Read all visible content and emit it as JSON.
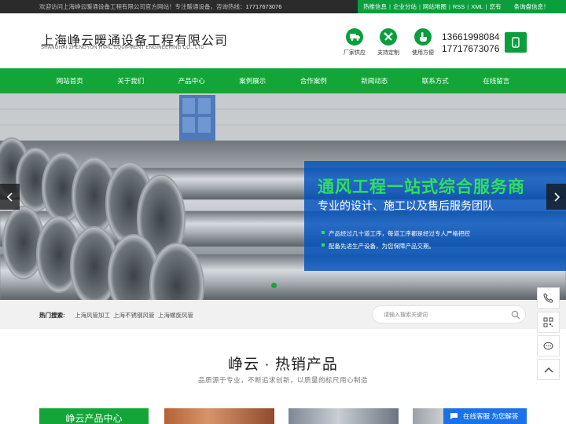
{
  "topbar": {
    "welcome": "欢迎访问上海峥云暖通设备工程有限公司官方网站！专注暖通设备，咨询热线：",
    "hotline": "17717673076",
    "links": [
      "热推信息",
      "企业分站",
      "网站地图",
      "RSS",
      "XML",
      "您有",
      "条询盘信息！"
    ]
  },
  "header": {
    "company_cn": "上海峥云暖通设备工程有限公司",
    "company_en": "SHANGHAI ZHENGYUN HVAC EQUIPMENT ENGINEERING CO., LTD",
    "features": [
      {
        "label": "厂家供应",
        "icon": "truck-icon"
      },
      {
        "label": "支持定制",
        "icon": "tools-icon"
      },
      {
        "label": "使用方便",
        "icon": "hand-icon"
      }
    ],
    "phone1": "13661998084",
    "phone2": "17717673076"
  },
  "nav": [
    "网站首页",
    "关于我们",
    "产品中心",
    "案例展示",
    "合作案例",
    "新闻动态",
    "联系方式",
    "在线留言"
  ],
  "banner": {
    "headline": "通风工程一站式综合服务商",
    "subheadline": "专业的设计、施工以及售后服务团队",
    "points": [
      "产品经过几十道工序，每道工序都是经过专人严格把控",
      "配备先进生产设备，为您保障产品交期。"
    ]
  },
  "search": {
    "hot_label": "热门搜索:",
    "hot_links": [
      "上海风管加工",
      "上海不锈钢风管",
      "上海螺旋风管"
    ],
    "placeholder": "请输入搜索关键词"
  },
  "products": {
    "title": "峥云 · 热销产品",
    "subtitle": "品质源于专业，不断追求创新，以质量的标尺用心制造",
    "center_label": "峥云产品中心"
  },
  "chat": {
    "label": "在线客服 为您解答"
  },
  "colors": {
    "brand_green": "#13a538",
    "panel_blue": "#0052be",
    "headline_green": "#2ee05a"
  }
}
